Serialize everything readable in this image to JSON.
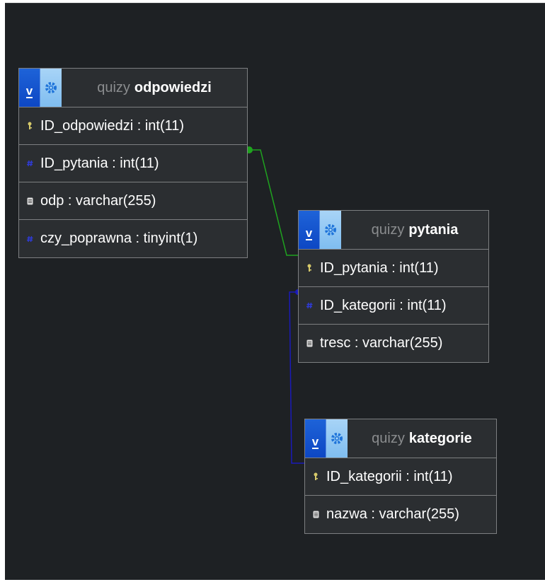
{
  "tables": {
    "odpowiedzi": {
      "db": "quizy",
      "name": "odpowiedzi",
      "columns": [
        {
          "label": "ID_odpowiedzi : int(11)",
          "icon": "primary-key-icon"
        },
        {
          "label": "ID_pytania : int(11)",
          "icon": "hash-icon"
        },
        {
          "label": "odp : varchar(255)",
          "icon": "text-icon"
        },
        {
          "label": "czy_poprawna : tinyint(1)",
          "icon": "hash-icon"
        }
      ]
    },
    "pytania": {
      "db": "quizy",
      "name": "pytania",
      "columns": [
        {
          "label": "ID_pytania : int(11)",
          "icon": "primary-key-icon"
        },
        {
          "label": "ID_kategorii : int(11)",
          "icon": "hash-icon"
        },
        {
          "label": "tresc : varchar(255)",
          "icon": "text-icon"
        }
      ]
    },
    "kategorie": {
      "db": "quizy",
      "name": "kategorie",
      "columns": [
        {
          "label": "ID_kategorii : int(11)",
          "icon": "primary-key-icon"
        },
        {
          "label": "nazwa : varchar(255)",
          "icon": "text-icon"
        }
      ]
    }
  },
  "buttons": {
    "toggle": "v"
  },
  "colors": {
    "relation_1": "#1fa31f",
    "relation_2": "#1a1ab8",
    "key": "#d6c96a",
    "hash": "#2f3bd8"
  }
}
